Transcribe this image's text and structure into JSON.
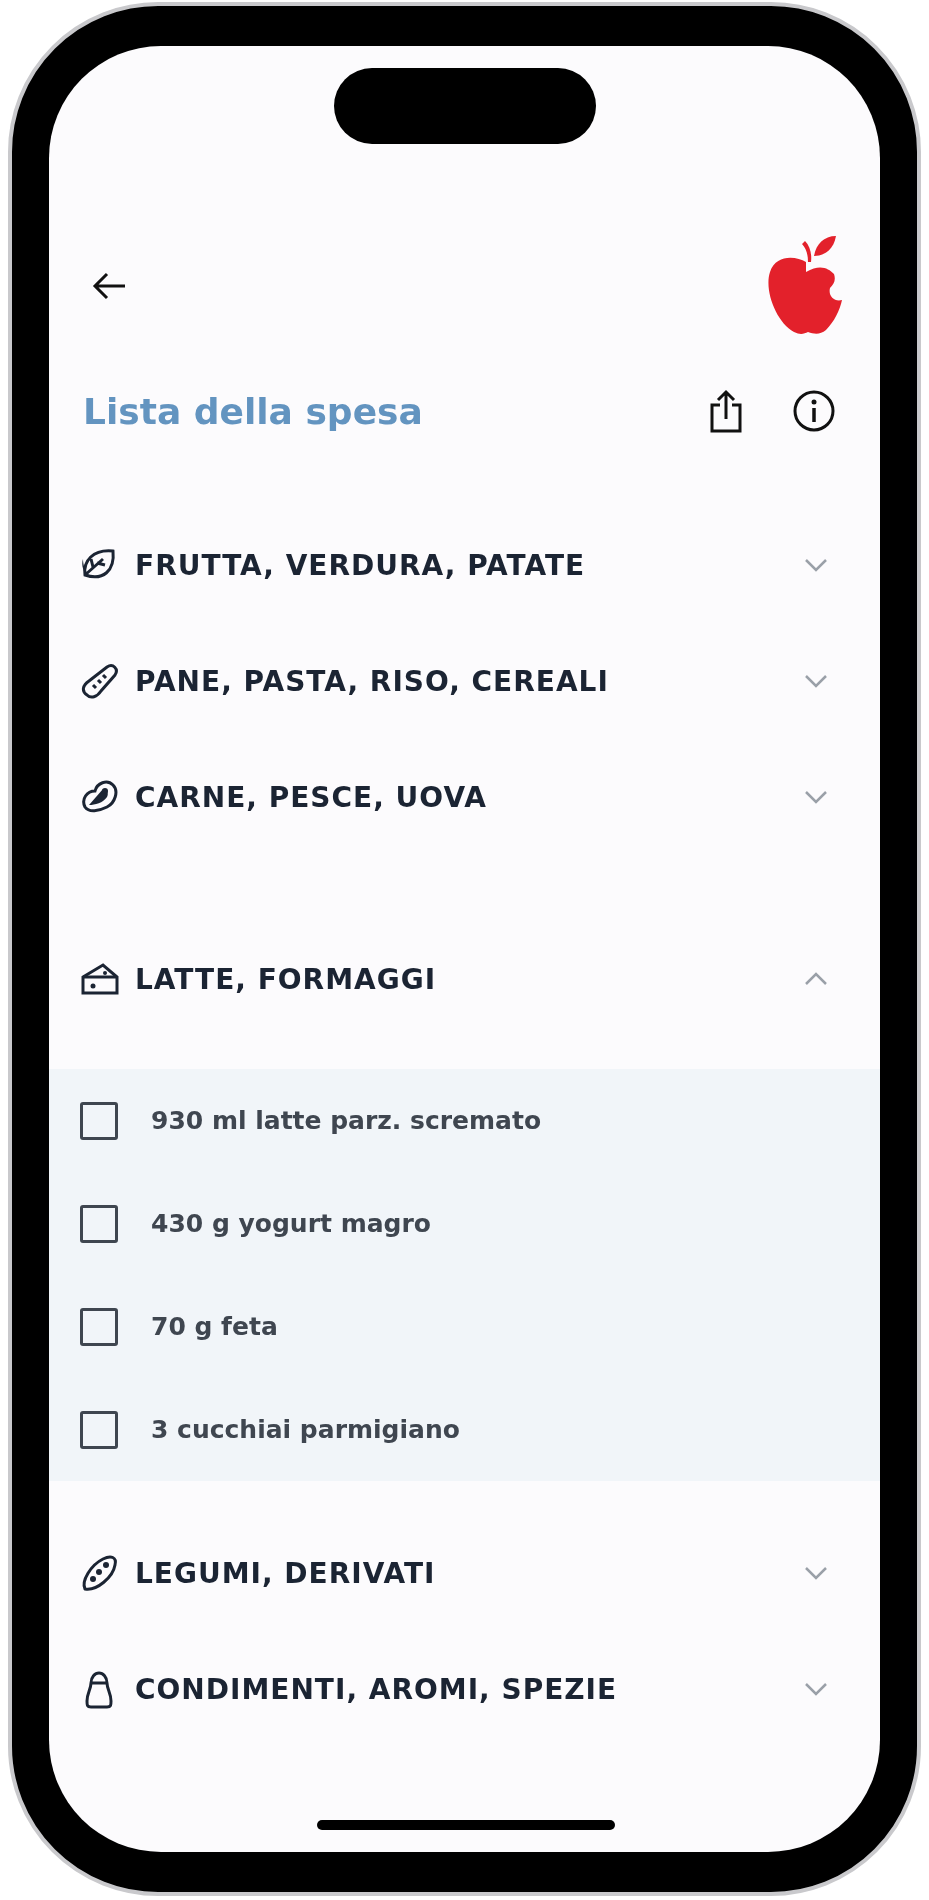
{
  "title": "Lista della spesa",
  "categories": [
    {
      "label": "FRUTTA, VERDURA, PATATE",
      "expanded": false
    },
    {
      "label": "PANE, PASTA, RISO, CEREALI",
      "expanded": false
    },
    {
      "label": "CARNE, PESCE, UOVA",
      "expanded": false
    },
    {
      "label": "LATTE, FORMAGGI",
      "expanded": true,
      "items": [
        {
          "label": "930 ml latte parz. scremato",
          "checked": false
        },
        {
          "label": "430 g yogurt magro",
          "checked": false
        },
        {
          "label": "70 g feta",
          "checked": false
        },
        {
          "label": "3 cucchiai parmigiano",
          "checked": false
        }
      ]
    },
    {
      "label": "LEGUMI, DERIVATI",
      "expanded": false
    },
    {
      "label": "CONDIMENTI, AROMI, SPEZIE",
      "expanded": false
    }
  ]
}
